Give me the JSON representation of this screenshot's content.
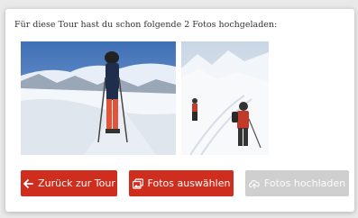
{
  "intro_text": "Für diese Tour hast du schon folgende 2 Fotos hochgeladen:",
  "photos": [
    {
      "alt": "Skitourengeherin auf verschneitem Grat"
    },
    {
      "alt": "Zwei Skitourengeher im Schnee"
    }
  ],
  "buttons": {
    "back_label": "Zurück zur Tour",
    "select_label": "Fotos auswählen",
    "upload_label": "Fotos hochladen"
  },
  "icons": {
    "back": "arrow-left-icon",
    "select": "images-icon",
    "upload": "cloud-upload-icon"
  },
  "colors": {
    "primary": "#cf2e1e",
    "disabled": "#cfcfcf"
  }
}
